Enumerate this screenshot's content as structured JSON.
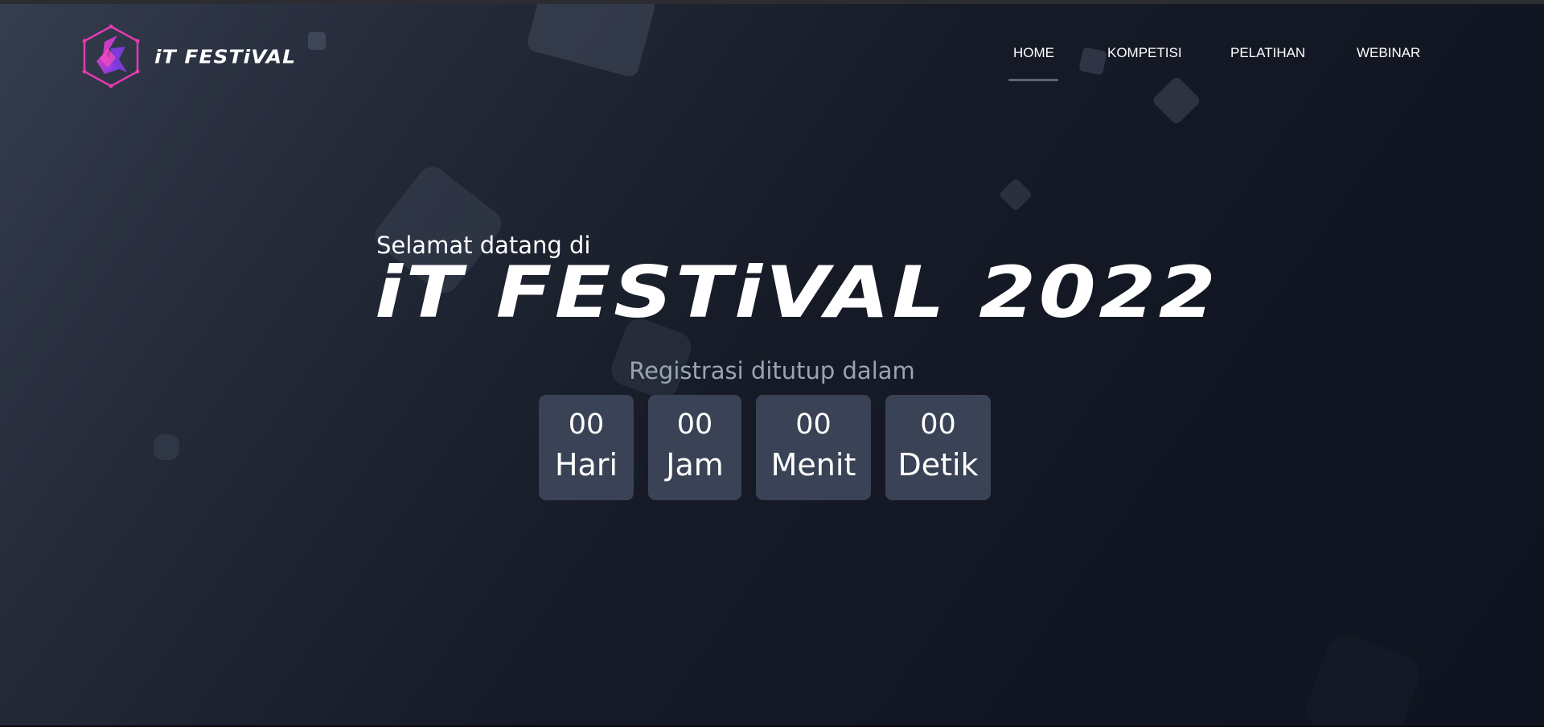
{
  "brand": {
    "name": "iT FESTiVAL",
    "accent_color": "#e43bb3",
    "accent_color_2": "#7a3cf0"
  },
  "nav": {
    "items": [
      {
        "label": "HOME",
        "active": true
      },
      {
        "label": "KOMPETISI",
        "active": false
      },
      {
        "label": "PELATIHAN",
        "active": false
      },
      {
        "label": "WEBINAR",
        "active": false
      }
    ]
  },
  "hero": {
    "welcome": "Selamat datang di",
    "title": "iT FESTiVAL 2022",
    "registration_label": "Registrasi ditutup dalam",
    "countdown": [
      {
        "value": "00",
        "unit": "Hari"
      },
      {
        "value": "00",
        "unit": "Jam"
      },
      {
        "value": "00",
        "unit": "Menit"
      },
      {
        "value": "00",
        "unit": "Detik"
      }
    ]
  }
}
